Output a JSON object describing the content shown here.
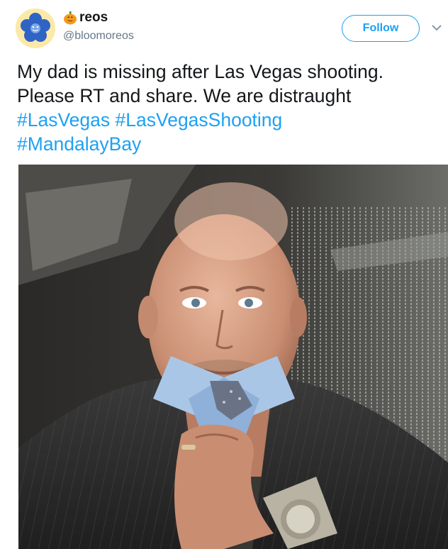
{
  "user": {
    "display_name": "reos",
    "handle": "@bloomoreos",
    "name_emoji": "jack-o-lantern-icon",
    "avatar": "blue-flower-avatar"
  },
  "actions": {
    "follow_label": "Follow",
    "menu": "chevron-down-icon"
  },
  "tweet": {
    "line1": "My dad is missing after Las Vegas shooting.",
    "line2": "Please RT and share. We are distraught",
    "hashtags": [
      "#LasVegas",
      "#LasVegasShooting",
      "#MandalayBay"
    ]
  },
  "colors": {
    "accent": "#1da1f2",
    "text": "#14171a",
    "secondary_text": "#657786"
  }
}
